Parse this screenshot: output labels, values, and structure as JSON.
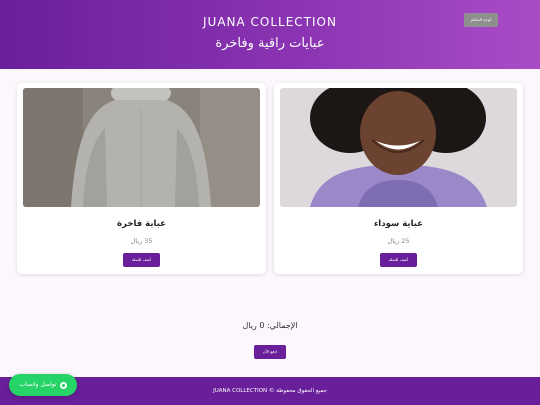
{
  "header": {
    "brand": "JUANA COLLECTION",
    "tagline": "عبايات راقية وفاخرة",
    "admin_button": "لوحة التحكم"
  },
  "products": [
    {
      "title": "عباية سوداء",
      "price": "25 ريال",
      "add_label": "أضف للسلة",
      "image": "woman-purple-hoodie-photo"
    },
    {
      "title": "عباية فاخرة",
      "price": "35 ريال",
      "add_label": "أضف للسلة",
      "image": "person-gray-sweater-photo"
    }
  ],
  "cart": {
    "total": "الإجمالي: 0 ريال",
    "pay_label": "ادفع الآن"
  },
  "footer": {
    "copyright": "جميع الحقوق محفوظة © JUANA COLLECTION"
  },
  "whatsapp": {
    "label": "تواصل واتساب",
    "icon": "whatsapp-icon"
  },
  "colors": {
    "primary": "#6a1f9a",
    "header_gradient_end": "#a94cc6",
    "whatsapp": "#25d366",
    "admin_button": "#8f8f8f"
  }
}
